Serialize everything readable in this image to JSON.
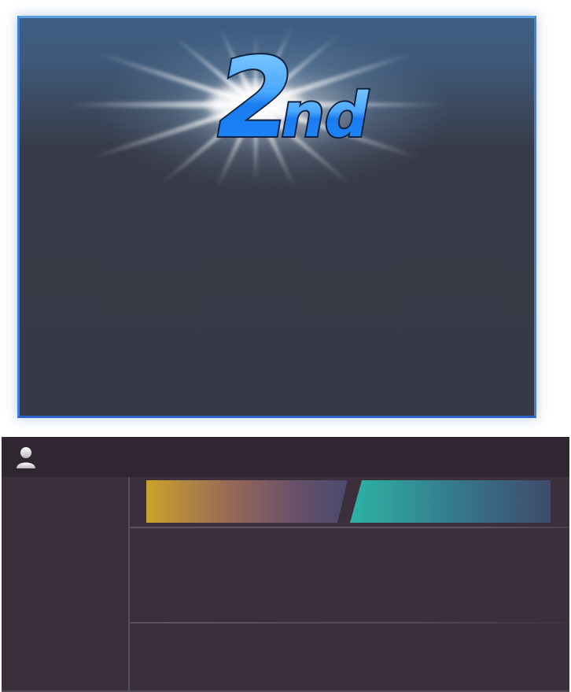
{
  "result": {
    "place_number": "2",
    "place_suffix": "nd"
  },
  "player": {
    "icon": "player-avatar-icon"
  },
  "colors": {
    "card_border": "#3f7fd6",
    "badge_blue": "#1e88ff",
    "bar_gold": "#c9a22c",
    "bar_teal": "#2db3a6",
    "panel_bg": "#3a2f3b"
  }
}
